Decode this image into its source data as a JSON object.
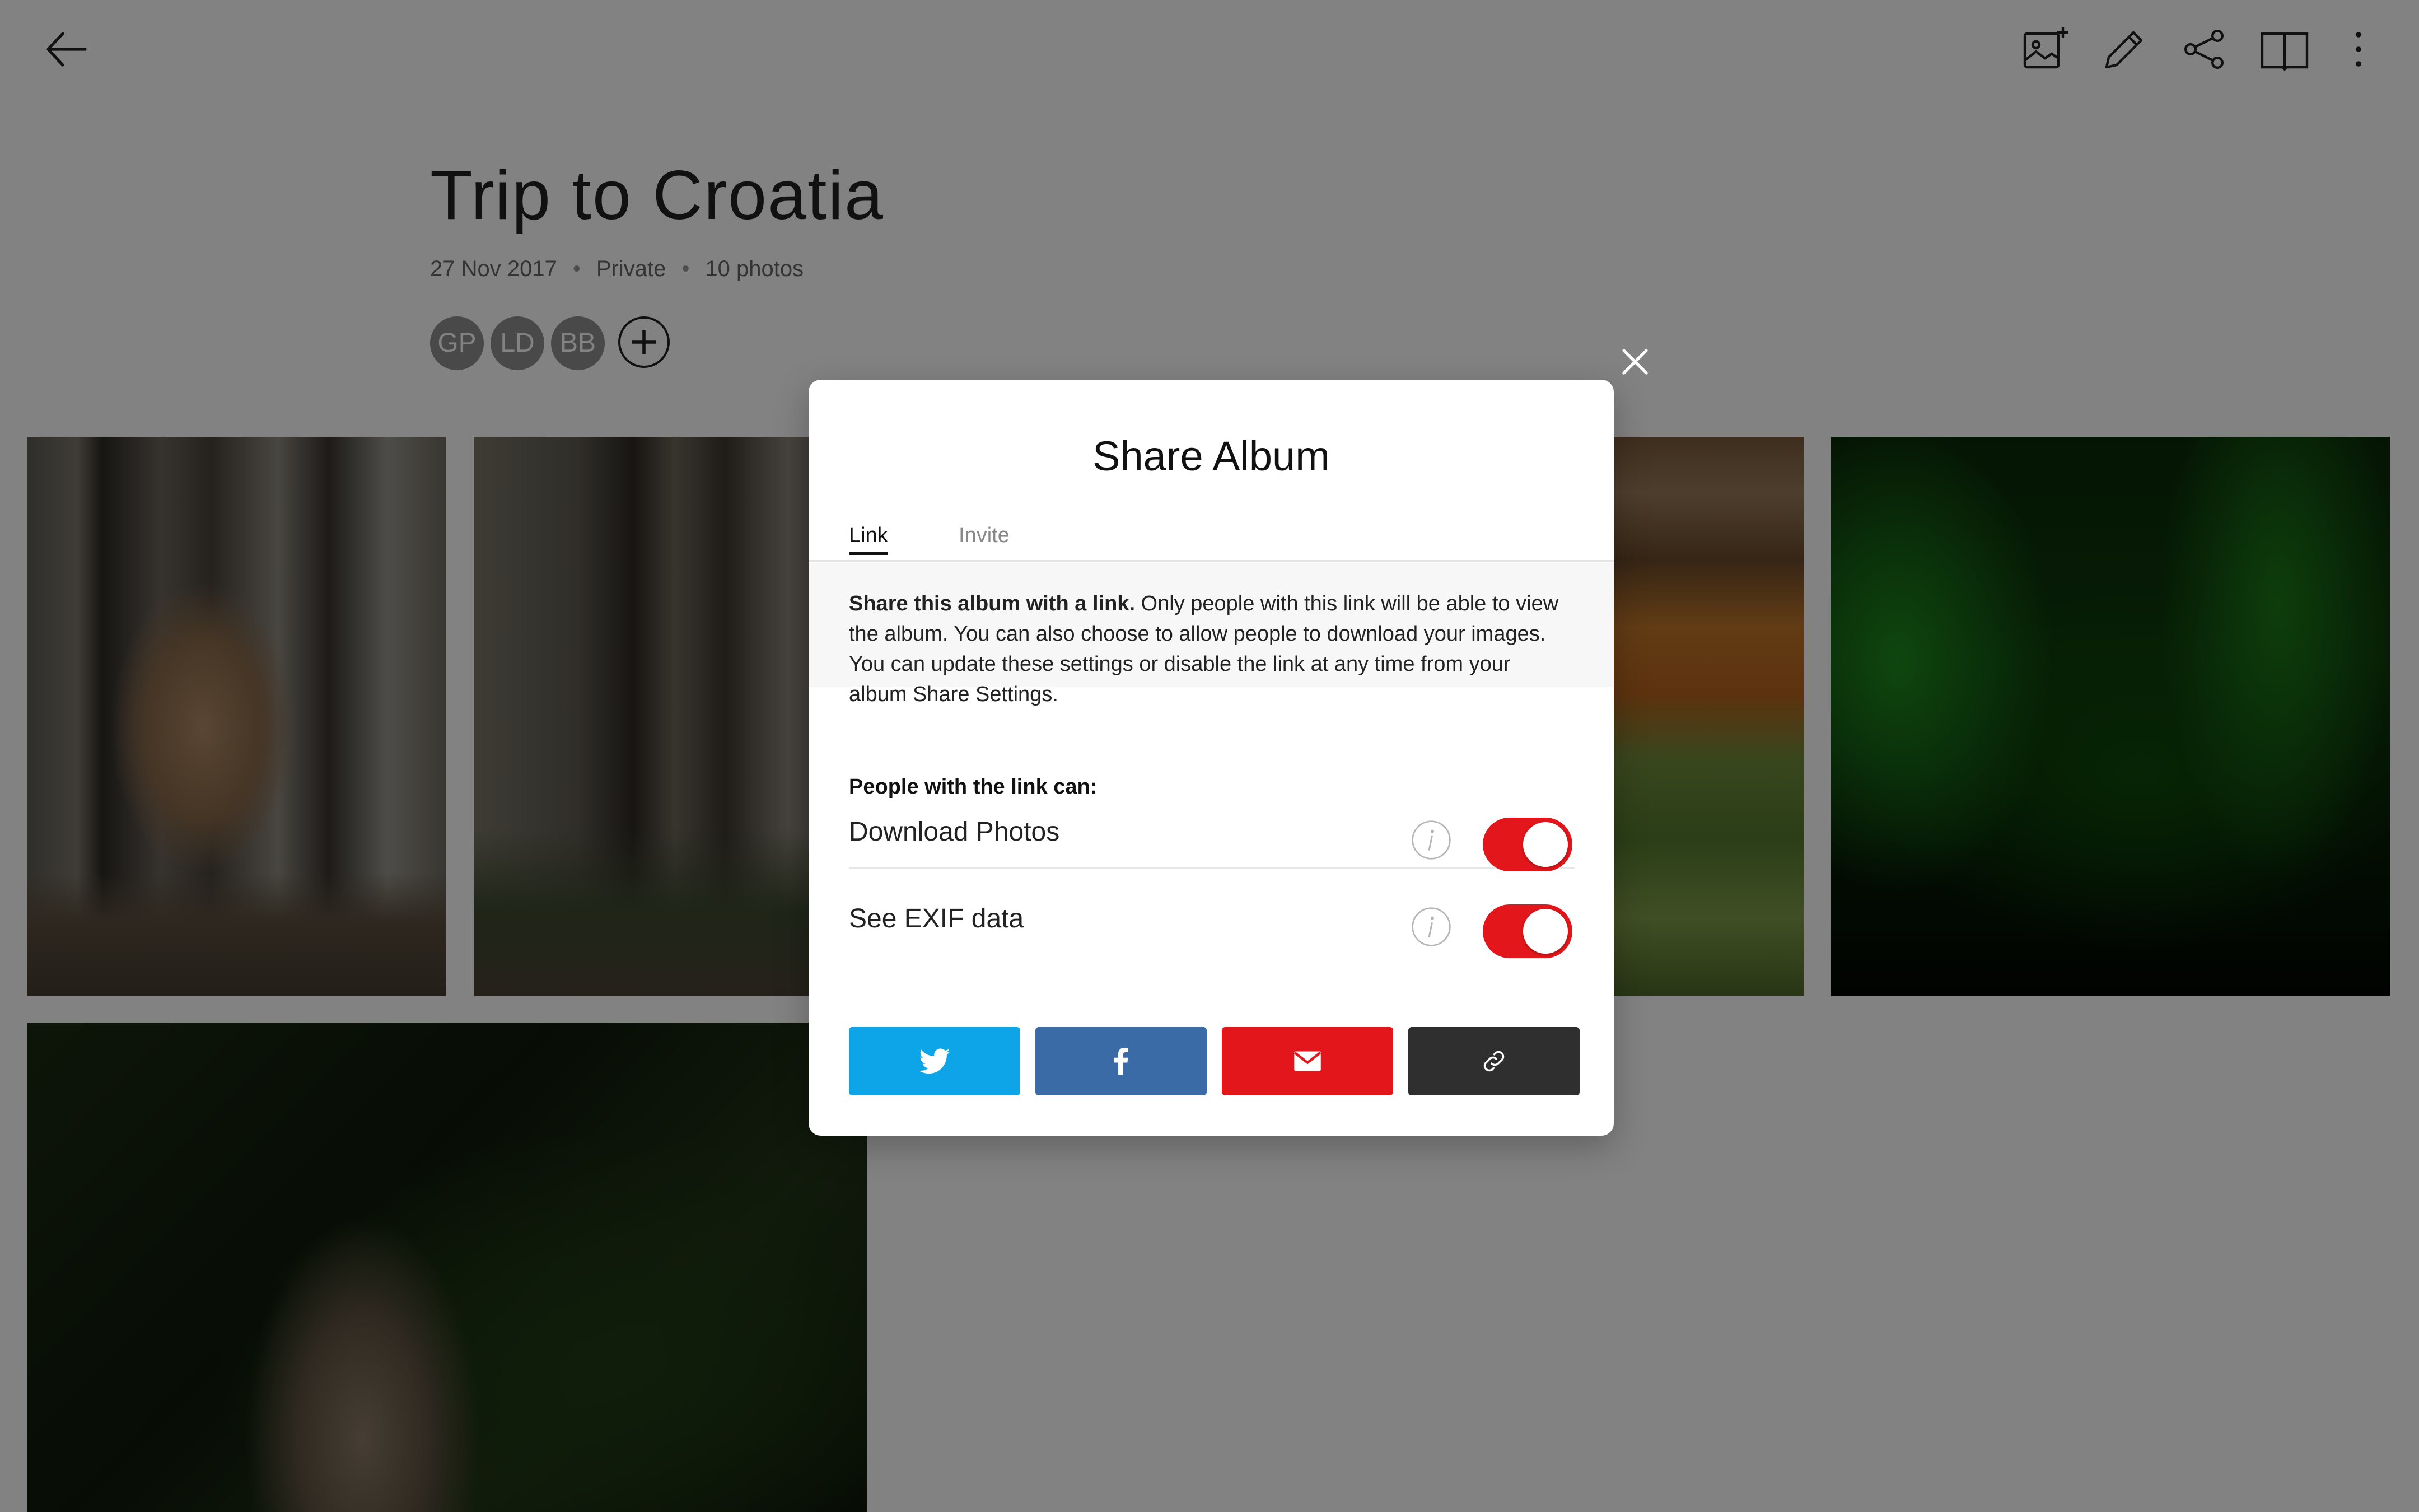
{
  "album": {
    "title": "Trip to Croatia",
    "date": "27 Nov 2017",
    "privacy": "Private",
    "photo_count": "10 photos",
    "collaborators": [
      "GP",
      "LD",
      "BB"
    ]
  },
  "toolbar": {
    "icons": [
      "add-photo-icon",
      "edit-icon",
      "share-icon",
      "book-icon",
      "more-icon"
    ]
  },
  "modal": {
    "title": "Share Album",
    "tabs": [
      {
        "label": "Link",
        "active": true
      },
      {
        "label": "Invite",
        "active": false
      }
    ],
    "description_lead": "Share this album with a link.",
    "description_body": " Only people with this link will be able to view the album. You can also choose to allow people to download your images. You can update these settings or disable the link at any time from your album Share Settings.",
    "permissions_heading": "People with the link can:",
    "permissions": [
      {
        "label": "Download Photos",
        "enabled": true
      },
      {
        "label": "See EXIF data",
        "enabled": true
      }
    ],
    "share_buttons": [
      "twitter-icon",
      "facebook-icon",
      "email-icon",
      "link-icon"
    ]
  },
  "colors": {
    "accent_red": "#e3171b",
    "twitter_blue": "#0ea5e8",
    "facebook_blue": "#3b6ba6",
    "copy_dark": "#2f2f2f",
    "overlay": "rgba(0,0,0,0.49)"
  }
}
